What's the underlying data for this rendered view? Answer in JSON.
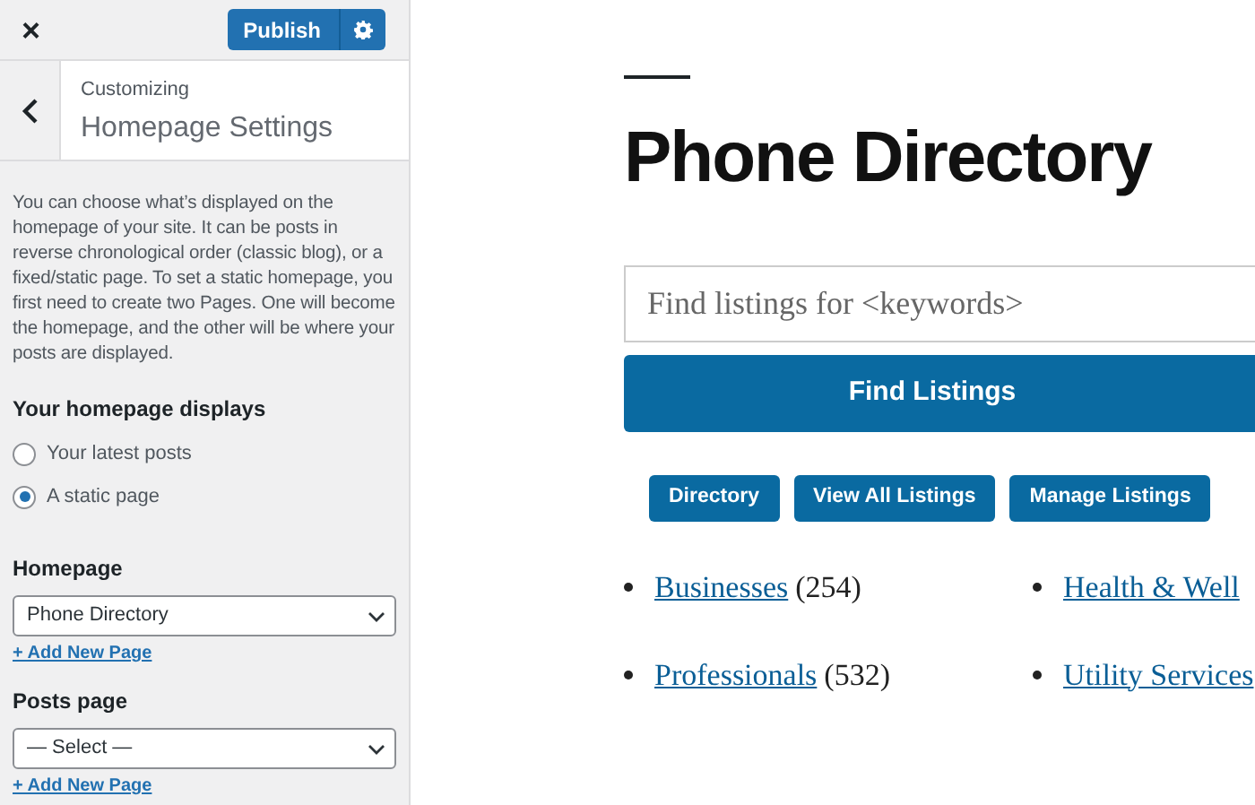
{
  "sidebar": {
    "close": "×",
    "publish_button": "Publish",
    "breadcrumb": "Customizing",
    "title": "Homepage Settings",
    "description": "You can choose what’s displayed on the homepage of your site. It can be posts in reverse chronological order (classic blog), or a fixed/static page. To set a static homepage, you first need to create two Pages. One will become the homepage, and the other will be where your posts are displayed.",
    "displays_label": "Your homepage displays",
    "options": [
      {
        "label": "Your latest posts",
        "selected": false
      },
      {
        "label": "A static page",
        "selected": true
      }
    ],
    "selects": [
      {
        "label": "Homepage",
        "value": "Phone Directory",
        "link": "+ Add New Page"
      },
      {
        "label": "Posts page",
        "value": "— Select —",
        "link": "+ Add New Page"
      }
    ]
  },
  "preview": {
    "title": "Phone Directory",
    "search": {
      "placeholder": "Find listings for <keywords>"
    },
    "search_button": "Find Listings",
    "buttons": [
      "Directory",
      "View All Listings",
      "Manage Listings"
    ],
    "categories": [
      {
        "name": "Businesses",
        "count": "(254)"
      },
      {
        "name": "Health & Well"
      },
      {
        "name": "Professionals",
        "count": "(532)"
      },
      {
        "name": "Utility Services"
      }
    ]
  }
}
